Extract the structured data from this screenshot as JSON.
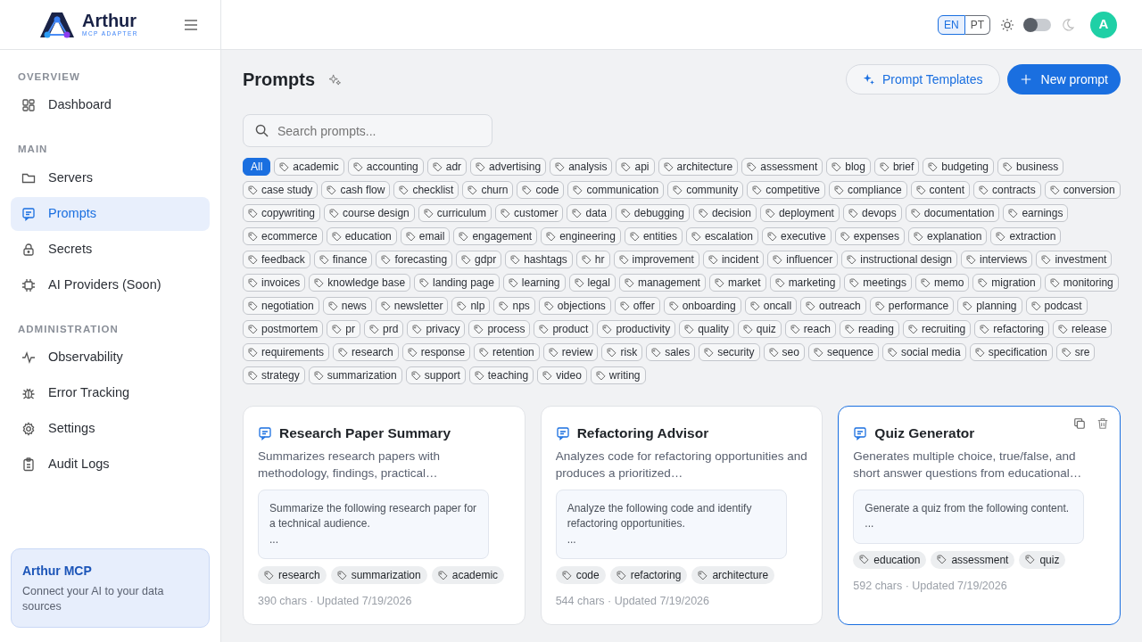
{
  "brand": {
    "name": "Arthur",
    "tagline": "MCP ADAPTER"
  },
  "sidebar": {
    "sections": [
      {
        "title": "OVERVIEW",
        "items": [
          {
            "label": "Dashboard",
            "kind": "grid",
            "selected": false
          }
        ]
      },
      {
        "title": "MAIN",
        "items": [
          {
            "label": "Servers",
            "kind": "folder",
            "selected": false
          },
          {
            "label": "Prompts",
            "kind": "message",
            "selected": true
          },
          {
            "label": "Secrets",
            "kind": "lock",
            "selected": false
          },
          {
            "label": "AI Providers (Soon)",
            "kind": "chip",
            "selected": false
          }
        ]
      },
      {
        "title": "ADMINISTRATION",
        "items": [
          {
            "label": "Observability",
            "kind": "pulse",
            "selected": false
          },
          {
            "label": "Error Tracking",
            "kind": "bug",
            "selected": false
          },
          {
            "label": "Settings",
            "kind": "gear",
            "selected": false
          },
          {
            "label": "Audit Logs",
            "kind": "clipboard",
            "selected": false
          }
        ]
      }
    ],
    "promo": {
      "title": "Arthur MCP",
      "text": "Connect your AI to your data sources"
    }
  },
  "topbar": {
    "languages": [
      {
        "label": "EN",
        "selected": true
      },
      {
        "label": "PT",
        "selected": false
      }
    ],
    "dark_mode": false,
    "avatar": "A"
  },
  "page": {
    "title": "Prompts",
    "buttons": [
      {
        "label": "Prompt Templates",
        "kind": "outline"
      },
      {
        "label": "New prompt",
        "kind": "primary"
      }
    ],
    "search": {
      "placeholder": "Search prompts..."
    },
    "tags": [
      {
        "label": "All",
        "selected": true
      },
      {
        "label": "academic",
        "selected": false
      },
      {
        "label": "accounting",
        "selected": false
      },
      {
        "label": "adr",
        "selected": false
      },
      {
        "label": "advertising",
        "selected": false
      },
      {
        "label": "analysis",
        "selected": false
      },
      {
        "label": "api",
        "selected": false
      },
      {
        "label": "architecture",
        "selected": false
      },
      {
        "label": "assessment",
        "selected": false
      },
      {
        "label": "blog",
        "selected": false
      },
      {
        "label": "brief",
        "selected": false
      },
      {
        "label": "budgeting",
        "selected": false
      },
      {
        "label": "business",
        "selected": false
      },
      {
        "label": "case study",
        "selected": false
      },
      {
        "label": "cash flow",
        "selected": false
      },
      {
        "label": "checklist",
        "selected": false
      },
      {
        "label": "churn",
        "selected": false
      },
      {
        "label": "code",
        "selected": false
      },
      {
        "label": "communication",
        "selected": false
      },
      {
        "label": "community",
        "selected": false
      },
      {
        "label": "competitive",
        "selected": false
      },
      {
        "label": "compliance",
        "selected": false
      },
      {
        "label": "content",
        "selected": false
      },
      {
        "label": "contracts",
        "selected": false
      },
      {
        "label": "conversion",
        "selected": false
      },
      {
        "label": "copywriting",
        "selected": false
      },
      {
        "label": "course design",
        "selected": false
      },
      {
        "label": "curriculum",
        "selected": false
      },
      {
        "label": "customer",
        "selected": false
      },
      {
        "label": "data",
        "selected": false
      },
      {
        "label": "debugging",
        "selected": false
      },
      {
        "label": "decision",
        "selected": false
      },
      {
        "label": "deployment",
        "selected": false
      },
      {
        "label": "devops",
        "selected": false
      },
      {
        "label": "documentation",
        "selected": false
      },
      {
        "label": "earnings",
        "selected": false
      },
      {
        "label": "ecommerce",
        "selected": false
      },
      {
        "label": "education",
        "selected": false
      },
      {
        "label": "email",
        "selected": false
      },
      {
        "label": "engagement",
        "selected": false
      },
      {
        "label": "engineering",
        "selected": false
      },
      {
        "label": "entities",
        "selected": false
      },
      {
        "label": "escalation",
        "selected": false
      },
      {
        "label": "executive",
        "selected": false
      },
      {
        "label": "expenses",
        "selected": false
      },
      {
        "label": "explanation",
        "selected": false
      },
      {
        "label": "extraction",
        "selected": false
      },
      {
        "label": "feedback",
        "selected": false
      },
      {
        "label": "finance",
        "selected": false
      },
      {
        "label": "forecasting",
        "selected": false
      },
      {
        "label": "gdpr",
        "selected": false
      },
      {
        "label": "hashtags",
        "selected": false
      },
      {
        "label": "hr",
        "selected": false
      },
      {
        "label": "improvement",
        "selected": false
      },
      {
        "label": "incident",
        "selected": false
      },
      {
        "label": "influencer",
        "selected": false
      },
      {
        "label": "instructional design",
        "selected": false
      },
      {
        "label": "interviews",
        "selected": false
      },
      {
        "label": "investment",
        "selected": false
      },
      {
        "label": "invoices",
        "selected": false
      },
      {
        "label": "knowledge base",
        "selected": false
      },
      {
        "label": "landing page",
        "selected": false
      },
      {
        "label": "learning",
        "selected": false
      },
      {
        "label": "legal",
        "selected": false
      },
      {
        "label": "management",
        "selected": false
      },
      {
        "label": "market",
        "selected": false
      },
      {
        "label": "marketing",
        "selected": false
      },
      {
        "label": "meetings",
        "selected": false
      },
      {
        "label": "memo",
        "selected": false
      },
      {
        "label": "migration",
        "selected": false
      },
      {
        "label": "monitoring",
        "selected": false
      },
      {
        "label": "negotiation",
        "selected": false
      },
      {
        "label": "news",
        "selected": false
      },
      {
        "label": "newsletter",
        "selected": false
      },
      {
        "label": "nlp",
        "selected": false
      },
      {
        "label": "nps",
        "selected": false
      },
      {
        "label": "objections",
        "selected": false
      },
      {
        "label": "offer",
        "selected": false
      },
      {
        "label": "onboarding",
        "selected": false
      },
      {
        "label": "oncall",
        "selected": false
      },
      {
        "label": "outreach",
        "selected": false
      },
      {
        "label": "performance",
        "selected": false
      },
      {
        "label": "planning",
        "selected": false
      },
      {
        "label": "podcast",
        "selected": false
      },
      {
        "label": "postmortem",
        "selected": false
      },
      {
        "label": "pr",
        "selected": false
      },
      {
        "label": "prd",
        "selected": false
      },
      {
        "label": "privacy",
        "selected": false
      },
      {
        "label": "process",
        "selected": false
      },
      {
        "label": "product",
        "selected": false
      },
      {
        "label": "productivity",
        "selected": false
      },
      {
        "label": "quality",
        "selected": false
      },
      {
        "label": "quiz",
        "selected": false
      },
      {
        "label": "reach",
        "selected": false
      },
      {
        "label": "reading",
        "selected": false
      },
      {
        "label": "recruiting",
        "selected": false
      },
      {
        "label": "refactoring",
        "selected": false
      },
      {
        "label": "release",
        "selected": false
      },
      {
        "label": "requirements",
        "selected": false
      },
      {
        "label": "research",
        "selected": false
      },
      {
        "label": "response",
        "selected": false
      },
      {
        "label": "retention",
        "selected": false
      },
      {
        "label": "review",
        "selected": false
      },
      {
        "label": "risk",
        "selected": false
      },
      {
        "label": "sales",
        "selected": false
      },
      {
        "label": "security",
        "selected": false
      },
      {
        "label": "seo",
        "selected": false
      },
      {
        "label": "sequence",
        "selected": false
      },
      {
        "label": "social media",
        "selected": false
      },
      {
        "label": "specification",
        "selected": false
      },
      {
        "label": "sre",
        "selected": false
      },
      {
        "label": "strategy",
        "selected": false
      },
      {
        "label": "summarization",
        "selected": false
      },
      {
        "label": "support",
        "selected": false
      },
      {
        "label": "teaching",
        "selected": false
      },
      {
        "label": "video",
        "selected": false
      },
      {
        "label": "writing",
        "selected": false
      }
    ],
    "cards": [
      {
        "title": "Research Paper Summary",
        "description": "Summarizes research papers with methodology, findings, practical…",
        "preview": [
          "Summarize the following research paper for a technical audience.",
          "..."
        ],
        "tags": [
          "research",
          "summarization",
          "academic"
        ],
        "meta": "390 chars · Updated 7/19/2026",
        "selected": false
      },
      {
        "title": "Refactoring Advisor",
        "description": "Analyzes code for refactoring opportunities and produces a prioritized…",
        "preview": [
          "Analyze the following code and identify refactoring opportunities.",
          "..."
        ],
        "tags": [
          "code",
          "refactoring",
          "architecture"
        ],
        "meta": "544 chars · Updated 7/19/2026",
        "selected": false
      },
      {
        "title": "Quiz Generator",
        "description": "Generates multiple choice, true/false, and short answer questions from educational…",
        "preview": [
          "Generate a quiz from the following content.",
          "..."
        ],
        "tags": [
          "education",
          "assessment",
          "quiz"
        ],
        "meta": "592 chars · Updated 7/19/2026",
        "selected": true
      }
    ]
  }
}
